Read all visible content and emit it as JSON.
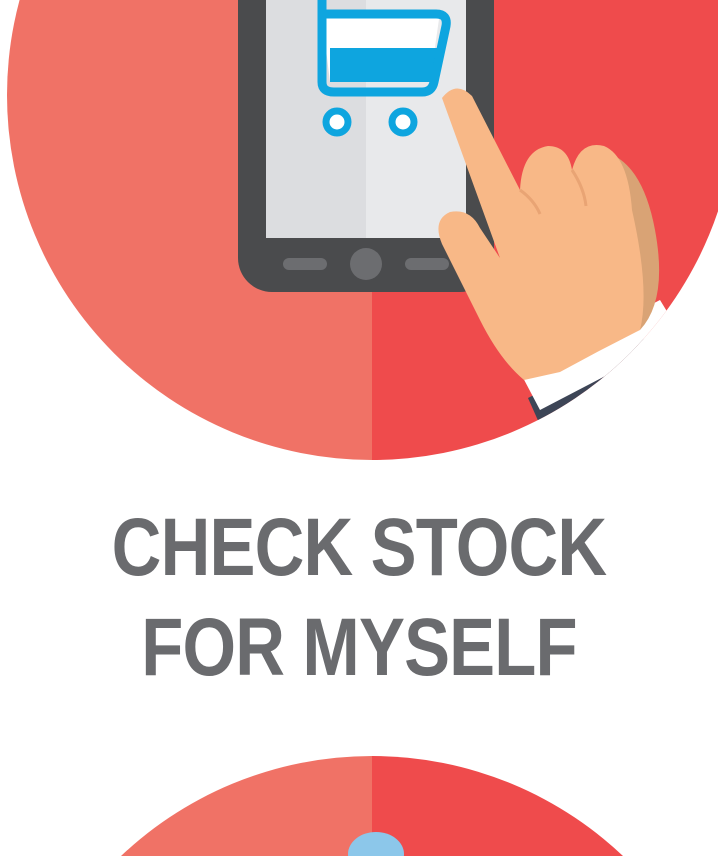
{
  "headline": {
    "line1": "CHECK STOCK",
    "line2": "FOR MYSELF"
  },
  "icons": {
    "top": "phone-shopping-cart-tap-icon",
    "bottom": "partial-circle-icon"
  },
  "colors": {
    "circle_left": "#f07266",
    "circle_right": "#ef4b4c",
    "headline_text": "#6a6b6e",
    "phone_body": "#4a4b4d",
    "screen": "#e8e9eb",
    "cart_blue": "#0ea5df",
    "hand_skin": "#f8b887",
    "hand_shadow": "#d9a375",
    "sleeve": "#3d4556",
    "cuff": "#ffffff",
    "bubble_blue": "#8cc7ea"
  }
}
